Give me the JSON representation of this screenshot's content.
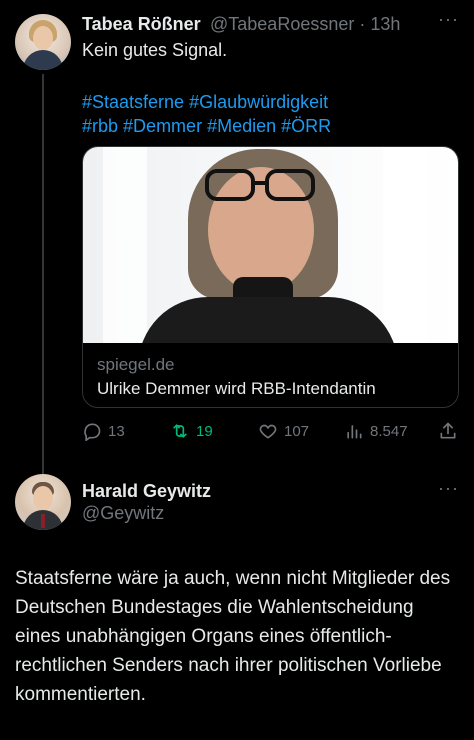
{
  "tweet1": {
    "author_name": "Tabea Rößner",
    "meta": "@TabeaRoessner · 13h",
    "more": "···",
    "text": "Kein gutes Signal.",
    "hashtags_line1": [
      "#Staatsferne",
      "#Glaubwürdigkeit"
    ],
    "hashtags_line2": [
      "#rbb",
      "#Demmer",
      "#Medien",
      "#ÖRR"
    ],
    "card": {
      "domain": "spiegel.de",
      "title": "Ulrike Demmer wird RBB-Intendantin"
    },
    "actions": {
      "replies": "13",
      "retweets": "19",
      "likes": "107",
      "views": "8.547"
    }
  },
  "tweet2": {
    "author_name": "Harald Geywitz",
    "handle": "@Geywitz",
    "more": "···",
    "text": "Staatsferne wäre ja auch, wenn nicht Mitglieder des Deutschen Bundestages die Wahlentscheidung eines unabhängigen Organs eines öffentlich-rechtlichen Senders nach ihrer politischen Vorliebe kommentierten."
  },
  "colors": {
    "background": "#000000",
    "text": "#e7e9ea",
    "secondary": "#71767b",
    "link": "#1d9bf0",
    "retweet": "#00ba7c"
  }
}
